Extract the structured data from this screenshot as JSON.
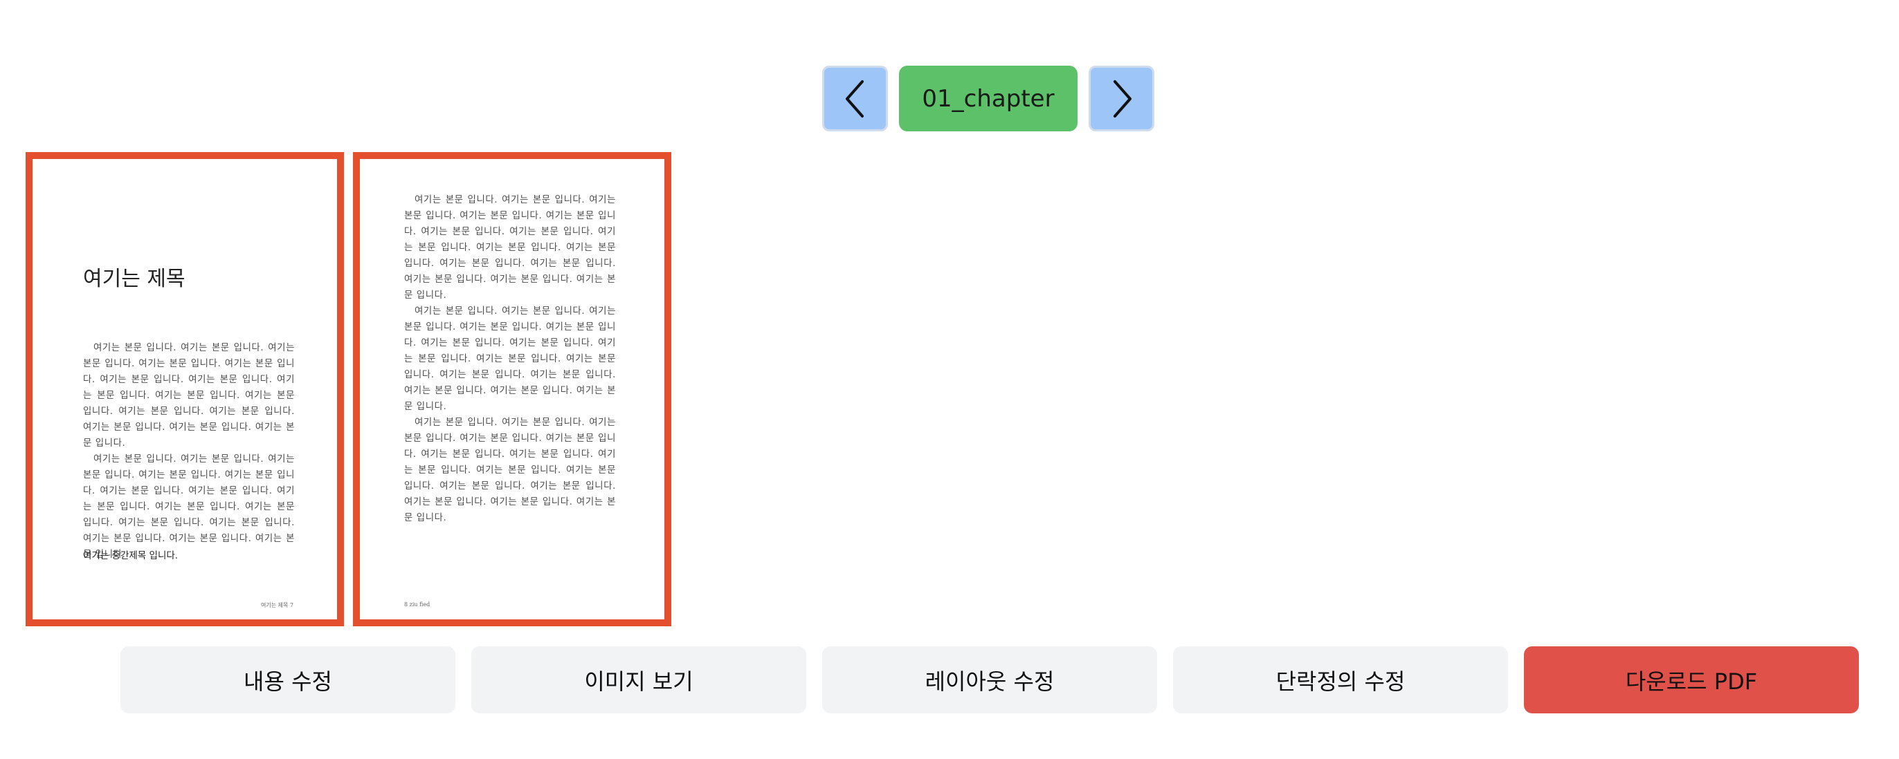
{
  "chapter_nav": {
    "prev_icon": "chevron-left-icon",
    "next_icon": "chevron-right-icon",
    "chapter_name": "01_chapter",
    "colors": {
      "nav_button": "#9ec5f8",
      "chapter_button": "#5cc169"
    }
  },
  "pages": [
    {
      "title": "여기는 제목",
      "paragraphs": [
        "여기는 본문 입니다. 여기는 본문 입니다. 여기는 본문 입니다. 여기는 본문 입니다. 여기는 본문 입니다. 여기는 본문 입니다. 여기는 본문 입니다. 여기는 본문 입니다. 여기는 본문 입니다. 여기는 본문 입니다. 여기는 본문 입니다. 여기는 본문 입니다. 여기는 본문 입니다. 여기는 본문 입니다. 여기는 본문 입니다.",
        "여기는 본문 입니다. 여기는 본문 입니다. 여기는 본문 입니다. 여기는 본문 입니다. 여기는 본문 입니다. 여기는 본문 입니다. 여기는 본문 입니다. 여기는 본문 입니다. 여기는 본문 입니다. 여기는 본문 입니다. 여기는 본문 입니다. 여기는 본문 입니다. 여기는 본문 입니다. 여기는 본문 입니다. 여기는 본문 입니다."
      ],
      "subheading": "여기는 중간제목 입니다.",
      "footer": "여기는 제목 7"
    },
    {
      "paragraphs": [
        "여기는 본문 입니다. 여기는 본문 입니다. 여기는 본문 입니다. 여기는 본문 입니다. 여기는 본문 입니다. 여기는 본문 입니다. 여기는 본문 입니다. 여기는 본문 입니다. 여기는 본문 입니다. 여기는 본문 입니다. 여기는 본문 입니다. 여기는 본문 입니다. 여기는 본문 입니다. 여기는 본문 입니다. 여기는 본문 입니다.",
        "여기는 본문 입니다. 여기는 본문 입니다. 여기는 본문 입니다. 여기는 본문 입니다. 여기는 본문 입니다. 여기는 본문 입니다. 여기는 본문 입니다. 여기는 본문 입니다. 여기는 본문 입니다. 여기는 본문 입니다. 여기는 본문 입니다. 여기는 본문 입니다. 여기는 본문 입니다. 여기는 본문 입니다. 여기는 본문 입니다.",
        "여기는 본문 입니다. 여기는 본문 입니다. 여기는 본문 입니다. 여기는 본문 입니다. 여기는 본문 입니다. 여기는 본문 입니다. 여기는 본문 입니다. 여기는 본문 입니다. 여기는 본문 입니다. 여기는 본문 입니다. 여기는 본문 입니다. 여기는 본문 입니다. 여기는 본문 입니다. 여기는 본문 입니다. 여기는 본문 입니다."
      ],
      "footer": "8 ziu fied"
    }
  ],
  "page_border_color": "#e4502e",
  "actions": {
    "edit_content": "내용 수정",
    "view_images": "이미지 보기",
    "edit_layout": "레이아웃 수정",
    "edit_paragraph_definition": "단락정의 수정",
    "download_pdf": "다운로드 PDF",
    "download_color": "#e0514a"
  }
}
